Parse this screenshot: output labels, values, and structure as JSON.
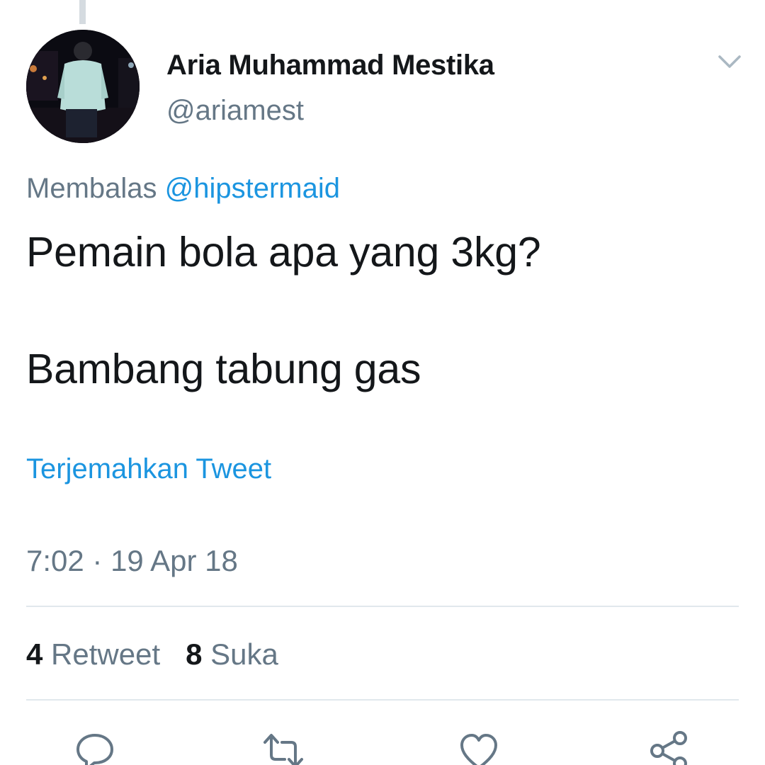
{
  "user": {
    "display_name": "Aria Muhammad Mestika",
    "handle": "@ariamest",
    "avatar_icon": "profile-photo"
  },
  "reply": {
    "prefix": "Membalas",
    "mention": "@hipstermaid"
  },
  "tweet": {
    "lines": [
      "Pemain bola apa yang 3kg?",
      "Bambang tabung gas"
    ]
  },
  "translate_label": "Terjemahkan Tweet",
  "timestamp": "7:02 · 19 Apr 18",
  "stats": {
    "retweets": {
      "count": "4",
      "label": "Retweet"
    },
    "likes": {
      "count": "8",
      "label": "Suka"
    }
  },
  "actions": [
    "reply-icon",
    "retweet-icon",
    "like-icon",
    "share-icon"
  ],
  "colors": {
    "text": "#14171a",
    "secondary": "#657786",
    "link": "#1b95e0",
    "divider": "#e1e8ed"
  }
}
